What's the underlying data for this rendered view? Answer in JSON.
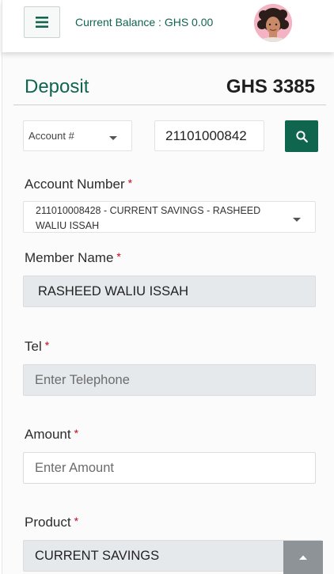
{
  "header": {
    "balance_label": "Current Balance : GHS 0.00"
  },
  "page": {
    "title": "Deposit",
    "amount": "GHS 3385"
  },
  "search": {
    "filter_selected": "Account #",
    "value": "21101000842"
  },
  "form": {
    "required_marker": "*",
    "account_number": {
      "label": "Account Number",
      "value": "211010008428 - CURRENT SAVINGS - RASHEED WALIU ISSAH"
    },
    "member_name": {
      "label": "Member Name",
      "value": "RASHEED WALIU ISSAH"
    },
    "tel": {
      "label": "Tel",
      "placeholder": "Enter Telephone"
    },
    "amount": {
      "label": "Amount",
      "placeholder": "Enter Amount"
    },
    "product": {
      "label": "Product",
      "value": "CURRENT SAVINGS"
    }
  },
  "icons": {
    "menu": "hamburger-icon",
    "search": "search-icon",
    "scroll_top": "chevron-up-icon"
  },
  "colors": {
    "brand": "#10654f",
    "required": "#d0021b",
    "readonly_bg": "#e6e9ec"
  }
}
